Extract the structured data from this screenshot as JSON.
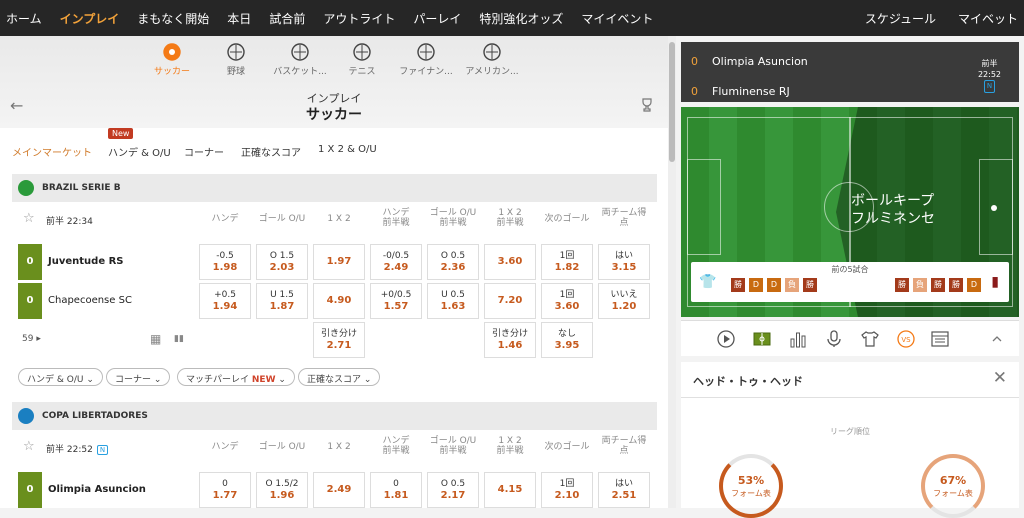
{
  "nav": {
    "left": [
      "ホーム",
      "インプレイ",
      "まもなく開始",
      "本日",
      "試合前",
      "アウトライト",
      "パーレイ",
      "特別強化オッズ",
      "マイイベント"
    ],
    "right": [
      "スケジュール",
      "マイベット"
    ]
  },
  "sports": [
    "サッカー",
    "野球",
    "バスケット...",
    "テニス",
    "ファイナン...",
    "アメリカン..."
  ],
  "header": {
    "subtitle": "インプレイ",
    "title": "サッカー"
  },
  "tabs": [
    "メインマーケット",
    "ハンデ & O/U",
    "コーナー",
    "正確なスコア",
    "1 X 2 & O/U"
  ],
  "new_badge": "New",
  "columns": [
    [
      "ハンデ"
    ],
    [
      "ゴール O/U"
    ],
    [
      "1 X 2"
    ],
    [
      "ハンデ",
      "前半戦"
    ],
    [
      "ゴール O/U",
      "前半戦"
    ],
    [
      "1 X 2",
      "前半戦"
    ],
    [
      "次のゴール"
    ],
    [
      "両チーム得",
      "点"
    ]
  ],
  "leagues": [
    {
      "name": "BRAZIL SERIE B",
      "time": "前半 22:34",
      "teams": [
        {
          "name": "Juventude RS",
          "score": "0"
        },
        {
          "name": "Chapecoense SC",
          "score": "0"
        }
      ],
      "odds": [
        [
          [
            "-0.5",
            "1.98"
          ],
          [
            "O 1.5",
            "2.03"
          ],
          [
            "",
            "1.97"
          ],
          [
            "-0/0.5",
            "2.49"
          ],
          [
            "O 0.5",
            "2.36"
          ],
          [
            "",
            "3.60"
          ],
          [
            "1回",
            "1.82"
          ],
          [
            "はい",
            "3.15"
          ]
        ],
        [
          [
            "+0.5",
            "1.94"
          ],
          [
            "U 1.5",
            "1.87"
          ],
          [
            "",
            "4.90"
          ],
          [
            "+0/0.5",
            "1.57"
          ],
          [
            "U 0.5",
            "1.63"
          ],
          [
            "",
            "7.20"
          ],
          [
            "1回",
            "3.60"
          ],
          [
            "いいえ",
            "1.20"
          ]
        ],
        [
          null,
          null,
          [
            "引き分け",
            "2.71"
          ],
          null,
          null,
          [
            "引き分け",
            "1.46"
          ],
          [
            "なし",
            "3.95"
          ],
          null
        ]
      ],
      "more": "59"
    },
    {
      "name": "COPA LIBERTADORES",
      "time": "前半 22:52",
      "badge": "N",
      "teams": [
        {
          "name": "Olimpia Asuncion",
          "score": "0"
        }
      ],
      "odds": [
        [
          [
            "0",
            "1.77"
          ],
          [
            "O 1.5/2",
            "1.96"
          ],
          [
            "",
            "2.49"
          ],
          [
            "0",
            "1.81"
          ],
          [
            "O 0.5",
            "2.17"
          ],
          [
            "",
            "4.15"
          ],
          [
            "1回",
            "2.10"
          ],
          [
            "はい",
            "2.51"
          ]
        ]
      ]
    }
  ],
  "filters": [
    {
      "label": "ハンデ & O/U"
    },
    {
      "label": "コーナー"
    },
    {
      "label": "マッチパーレイ",
      "tag": "NEW"
    },
    {
      "label": "正確なスコア"
    }
  ],
  "scoreboard": {
    "home": {
      "name": "Olimpia Asuncion",
      "score": "0"
    },
    "away": {
      "name": "Fluminense RJ",
      "score": "0"
    },
    "period": "前半",
    "time": "22:52",
    "badge": "N"
  },
  "pitch": {
    "event_line1": "ボールキープ",
    "event_line2": "フルミネンセ",
    "form_label": "前の5試合",
    "home_form": [
      "勝",
      "D",
      "D",
      "負",
      "勝"
    ],
    "away_form": [
      "勝",
      "負",
      "勝",
      "勝",
      "D"
    ]
  },
  "h2h": {
    "title": "ヘッド・トゥ・ヘッド",
    "league_rank": "リーグ順位",
    "home_pct": "53%",
    "away_pct": "67%",
    "form_label": "フォーム表"
  },
  "colors": {
    "accent": "#f2a23a",
    "odds": "#c65a1e",
    "score_bg": "#6a8f1d",
    "win": "#a33a1a",
    "draw": "#c86a10",
    "lose": "#e6a47a"
  }
}
